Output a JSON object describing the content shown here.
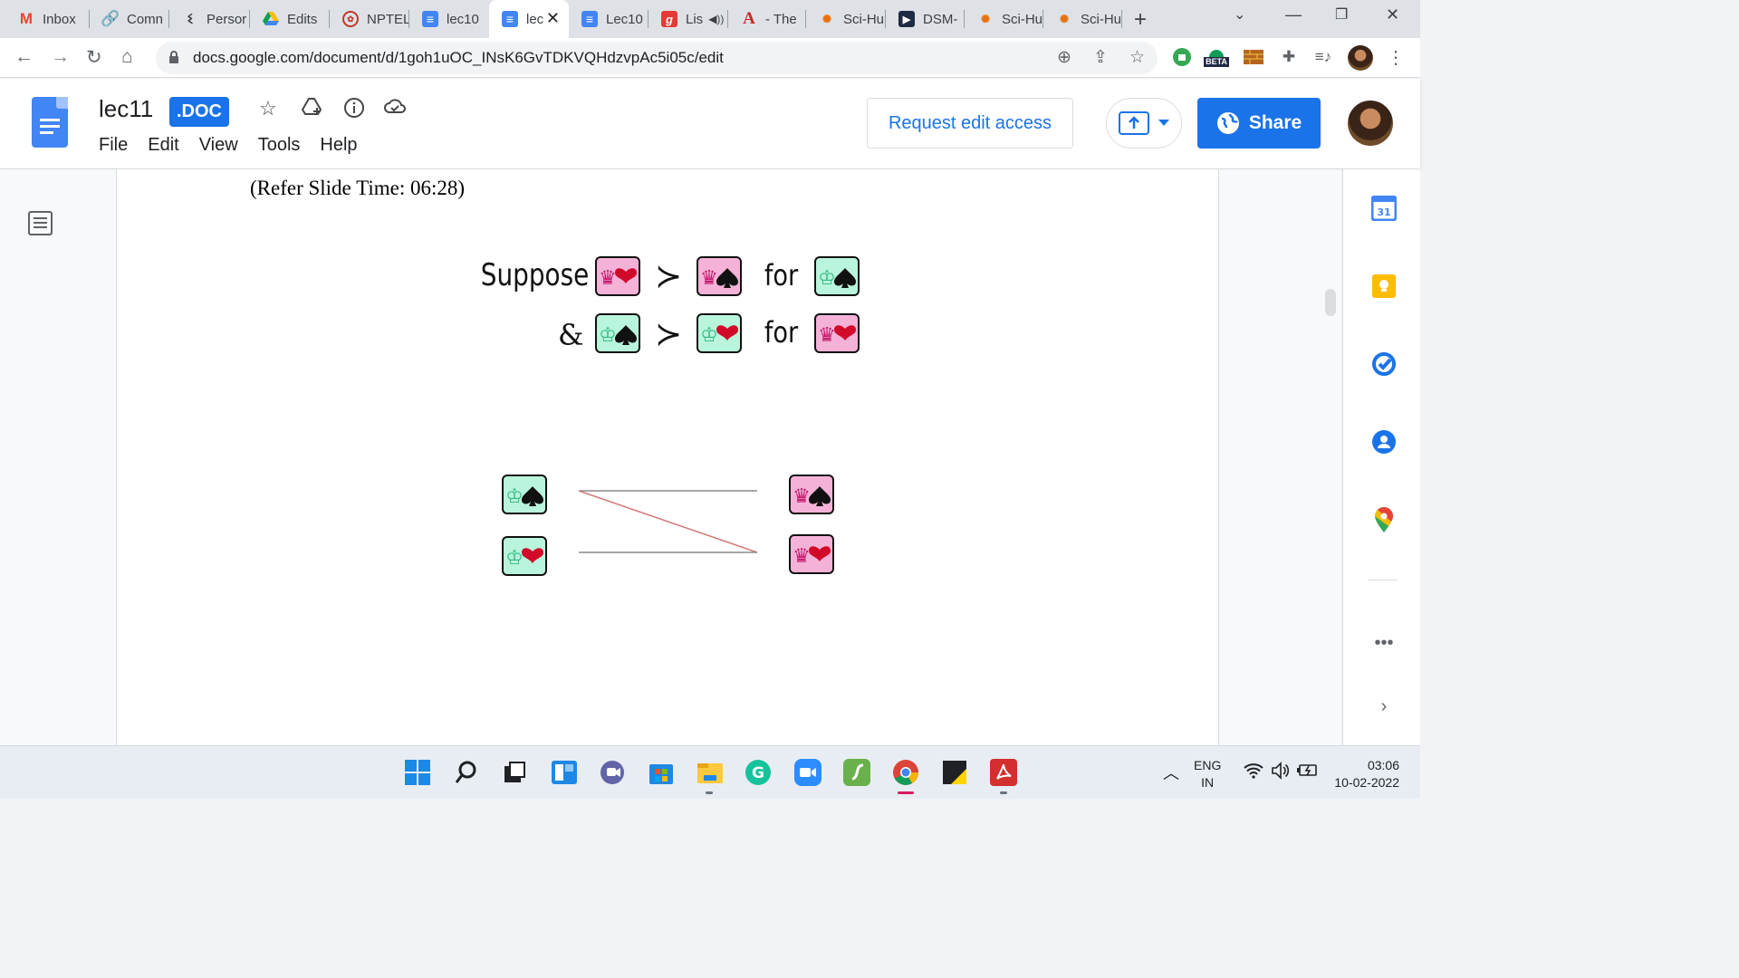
{
  "browser": {
    "tabs": [
      {
        "label": "Inbox",
        "icon": "gmail-icon"
      },
      {
        "label": "Comn",
        "icon": "link-icon"
      },
      {
        "label": "Persor",
        "icon": "dna-icon"
      },
      {
        "label": "Edits",
        "icon": "google-drive-icon"
      },
      {
        "label": "NPTEL",
        "icon": "nptel-icon"
      },
      {
        "label": "lec10",
        "icon": "google-docs-icon"
      },
      {
        "label": "lec",
        "icon": "google-docs-icon",
        "active": true
      },
      {
        "label": "Lec10",
        "icon": "google-docs-icon"
      },
      {
        "label": "Lis",
        "icon": "genius-icon"
      },
      {
        "label": "- The",
        "icon": "adobe-icon"
      },
      {
        "label": "Sci-Hu",
        "icon": "scihub-icon"
      },
      {
        "label": "DSM-",
        "icon": "arrow-play-icon"
      },
      {
        "label": "Sci-Hu",
        "icon": "scihub-icon"
      },
      {
        "label": "Sci-Hu",
        "icon": "scihub-icon"
      }
    ],
    "url": "docs.google.com/document/d/1goh1uOC_INsK6GvTDKVQHdzvpAc5i05c/edit",
    "beta_badge": "BETA"
  },
  "docs": {
    "title": "lec11",
    "badge": ".DOC",
    "menu": [
      "File",
      "Edit",
      "View",
      "Tools",
      "Help"
    ],
    "request_edit": "Request edit access",
    "share": "Share",
    "accent": "#1a73e8"
  },
  "document": {
    "refer_text": "(Refer Slide Time: 06:28)",
    "slide": {
      "line1": {
        "word": "Suppose",
        "left": "queen-hearts",
        "op": "≻",
        "right": "queen-spades",
        "for_word": "for",
        "for": "king-spades"
      },
      "line2": {
        "word": "&",
        "left": "king-spades",
        "op": "≻",
        "right": "king-hearts",
        "for_word": "for",
        "for": "queen-hearts"
      },
      "matching": {
        "left": [
          "king-spades",
          "king-hearts"
        ],
        "right": [
          "queen-spades",
          "queen-hearts"
        ],
        "edges": [
          [
            "king-spades",
            "queen-spades",
            "gray"
          ],
          [
            "king-spades",
            "queen-hearts",
            "red"
          ],
          [
            "king-hearts",
            "queen-hearts",
            "gray"
          ]
        ]
      },
      "colors": {
        "king_card": "#b9f5dc",
        "queen_card": "#f5b2d8",
        "king_symbol": "#33b886",
        "queen_symbol": "#c2186b",
        "heart": "#d10a2a",
        "spade": "#111111"
      }
    }
  },
  "taskbar": {
    "lang_top": "ENG",
    "lang_bottom": "IN",
    "time": "03:06",
    "date": "10-02-2022"
  }
}
